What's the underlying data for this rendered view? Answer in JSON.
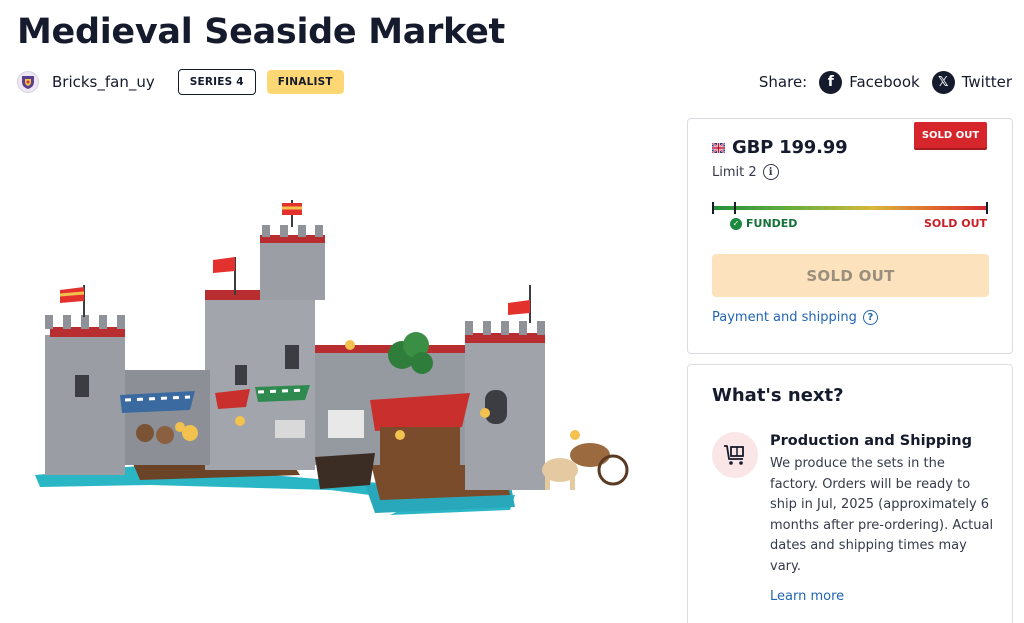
{
  "product": {
    "title": "Medieval Seaside Market",
    "creator": "Bricks_fan_uy",
    "series_badge": "SERIES 4",
    "status_badge": "FINALIST"
  },
  "share": {
    "label": "Share:",
    "facebook": "Facebook",
    "twitter": "Twitter"
  },
  "purchase": {
    "ribbon": "SOLD OUT",
    "currency_flag": "uk-flag-icon",
    "price": "GBP 199.99",
    "limit": "Limit 2",
    "progress": {
      "funded_label": "FUNDED",
      "soldout_label": "SOLD OUT",
      "fill_fraction": 1.0
    },
    "button_label": "SOLD OUT",
    "payment_link": "Payment and shipping"
  },
  "whats_next": {
    "title": "What's next?",
    "step_title": "Production and Shipping",
    "step_body": "We produce the sets in the factory. Orders will be ready to ship in Jul, 2025 (approximately 6 months after pre-ordering). Actual dates and shipping times may vary.",
    "learn_more": "Learn more"
  },
  "colors": {
    "text": "#151a2d",
    "link": "#2266b3",
    "sold_out_red": "#d6262b",
    "finalist_yellow": "#fcd773",
    "button_disabled": "#fde3bd"
  }
}
